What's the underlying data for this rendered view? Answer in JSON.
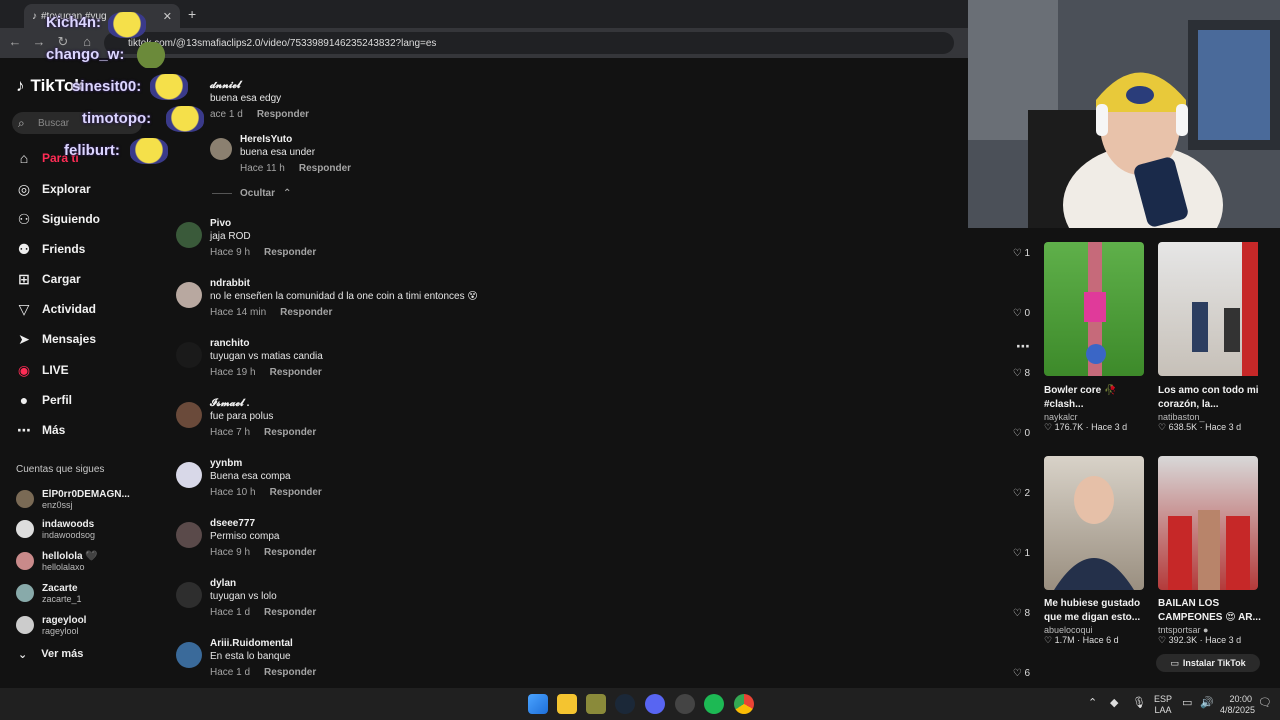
{
  "browser": {
    "tab_title": "#toyugan #yug",
    "url": "tiktok.com/@13smafiaclips2.0/video/7533989146235243832?lang=es"
  },
  "overlay_chat": [
    {
      "name": "Kich4n:"
    },
    {
      "name": "chango_w:"
    },
    {
      "name": "sinesit00:"
    },
    {
      "name": "timotopo:"
    },
    {
      "name": "feliburt:"
    }
  ],
  "sidebar": {
    "logo": "TikTok",
    "search_placeholder": "Buscar",
    "nav": [
      {
        "label": "Para ti",
        "icon": "home-icon"
      },
      {
        "label": "Explorar",
        "icon": "compass-icon"
      },
      {
        "label": "Siguiendo",
        "icon": "user-follow-icon"
      },
      {
        "label": "Friends",
        "icon": "friends-icon"
      },
      {
        "label": "Cargar",
        "icon": "upload-icon"
      },
      {
        "label": "Actividad",
        "icon": "activity-icon"
      },
      {
        "label": "Mensajes",
        "icon": "messages-icon"
      },
      {
        "label": "LIVE",
        "icon": "live-icon"
      },
      {
        "label": "Perfil",
        "icon": "profile-icon"
      },
      {
        "label": "Más",
        "icon": "more-icon"
      }
    ],
    "following_title": "Cuentas que sigues",
    "following": [
      {
        "name": "ElP0rr0DEMAGN...",
        "handle": "enz0ssj"
      },
      {
        "name": "indawoods",
        "handle": "indawoodsog"
      },
      {
        "name": "hellolola 🖤",
        "handle": "hellolalaxo"
      },
      {
        "name": "Zacarte",
        "handle": "zacarte_1"
      },
      {
        "name": "rageylool",
        "handle": "rageylool"
      }
    ],
    "ver_mas": "Ver más"
  },
  "comments": {
    "reply_label": "Responder",
    "ocultar": "Ocultar",
    "items": [
      {
        "user": "𝓭𝓷𝓷𝓲𝓮𝓵",
        "text": "buena esa edgy",
        "time": "ace 1 d",
        "likes": "1"
      },
      {
        "user": "HereIsYuto",
        "text": "buena esa under",
        "time": "Hace 11 h",
        "likes": ""
      },
      {
        "user": "Pivo",
        "text": "jaja ROD",
        "time": "Hace 9 h",
        "likes": "0"
      },
      {
        "user": "ndrabbit",
        "text": "no le enseñen la comunidad d la one coin a timi entonces 😵",
        "time": "Hace 14 min",
        "likes": "8"
      },
      {
        "user": "ranchito",
        "text": "tuyugan vs matias candia",
        "time": "Hace 19 h",
        "likes": "0"
      },
      {
        "user": "𝓘𝓼𝓶𝓪𝓮𝓵 .",
        "text": "fue para polus",
        "time": "Hace 7 h",
        "likes": "2"
      },
      {
        "user": "yynbm",
        "text": "Buena esa compa",
        "time": "Hace 10 h",
        "likes": "1"
      },
      {
        "user": "dseee777",
        "text": "Permiso compa",
        "time": "Hace 9 h",
        "likes": "8"
      },
      {
        "user": "dylan",
        "text": "tuyugan vs lolo",
        "time": "Hace 1 d",
        "likes": "6"
      },
      {
        "user": "Ariii.Ruidomental",
        "text": "En esta lo banque",
        "time": "Hace 1 d",
        "likes": ""
      }
    ]
  },
  "videos": [
    {
      "title": "Bowler core 🥀 #clash...",
      "author": "naykalcr",
      "stats": "♡ 176.7K · Hace 3 d"
    },
    {
      "title": "Los amo con todo mi corazón, la...",
      "author": "natibaston_",
      "stats": "♡ 638.5K · Hace 3 d"
    },
    {
      "title": "Me hubiese gustado que me digan esto...",
      "author": "abuelocoqui",
      "stats": "♡ 1.7M · Hace 6 d"
    },
    {
      "title": "BAILAN LOS CAMPEONES 😍 AR...",
      "author": "tntsportsar ●",
      "stats": "♡ 392.3K · Hace 3 d"
    }
  ],
  "install_label": "Instalar TikTok",
  "taskbar": {
    "lang1": "ESP",
    "lang2": "LAA",
    "time": "20:00",
    "date": "4/8/2025"
  },
  "colors": {
    "accent": "#fe2c55",
    "bg": "#121212"
  }
}
